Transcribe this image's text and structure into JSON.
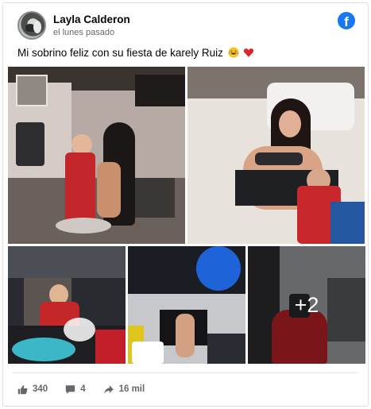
{
  "post": {
    "author": "Layla Calderon",
    "timestamp": "el lunes pasado",
    "text": "Mi sobrino feliz con su fiesta de karely Ruiz",
    "emojis": [
      "laughing-tears-emoji",
      "red-heart-emoji"
    ],
    "brand_logo": "facebook-icon",
    "brand_color": "#1877f2"
  },
  "photos": {
    "more_count_label": "+2"
  },
  "stats": {
    "likes": "340",
    "comments": "4",
    "shares": "16 mil",
    "icons": [
      "like-icon",
      "comment-icon",
      "share-icon"
    ]
  }
}
